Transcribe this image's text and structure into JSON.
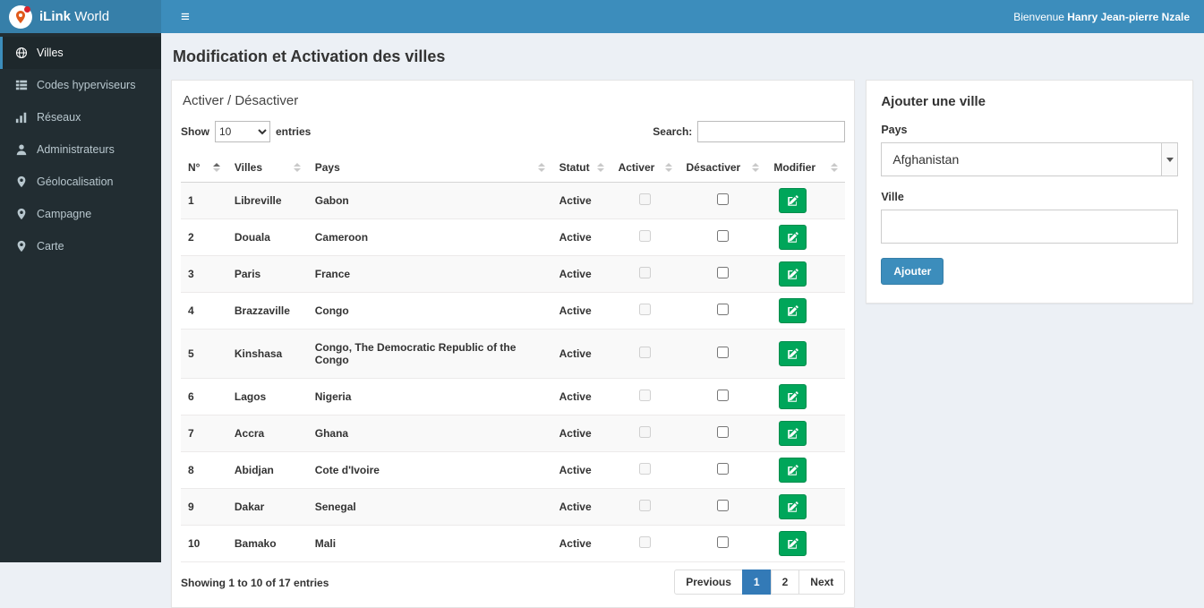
{
  "colors": {
    "header_bg": "#3c8dbc",
    "logo_bg": "#367fa9",
    "sidebar_bg": "#222d32",
    "sidebar_active_bg": "#1e282c",
    "edit_button_green": "#00a65a",
    "primary_button_blue": "#3c8dbc",
    "pagination_active_blue": "#337ab7",
    "body_bg": "#ecf0f5"
  },
  "header": {
    "menu_icon": "≡",
    "brand_bold": "iLink",
    "brand_rest": "World",
    "welcome_prefix": "Bienvenue",
    "welcome_name": "Hanry Jean-pierre Nzale"
  },
  "sidebar": {
    "items": [
      {
        "label": "Villes",
        "icon": "globe-icon",
        "active": true
      },
      {
        "label": "Codes hyperviseurs",
        "icon": "list-icon",
        "active": false
      },
      {
        "label": "Réseaux",
        "icon": "bar-chart-icon",
        "active": false
      },
      {
        "label": "Administrateurs",
        "icon": "user-icon",
        "active": false
      },
      {
        "label": "Géolocalisation",
        "icon": "map-marker-icon",
        "active": false
      },
      {
        "label": "Campagne",
        "icon": "map-marker-icon",
        "active": false
      },
      {
        "label": "Carte",
        "icon": "map-marker-icon",
        "active": false
      }
    ]
  },
  "page": {
    "title": "Modification et Activation des villes"
  },
  "table_panel": {
    "title": "Activer / Désactiver",
    "show_label": "Show",
    "entries_label": "entries",
    "page_length": "10",
    "search_label": "Search:",
    "search_value": "",
    "columns": [
      "N°",
      "Villes",
      "Pays",
      "Statut",
      "Activer",
      "Désactiver",
      "Modifier"
    ],
    "rows": [
      {
        "num": "1",
        "ville": "Libreville",
        "pays": "Gabon",
        "statut": "Active"
      },
      {
        "num": "2",
        "ville": "Douala",
        "pays": "Cameroon",
        "statut": "Active"
      },
      {
        "num": "3",
        "ville": "Paris",
        "pays": "France",
        "statut": "Active"
      },
      {
        "num": "4",
        "ville": "Brazzaville",
        "pays": "Congo",
        "statut": "Active"
      },
      {
        "num": "5",
        "ville": "Kinshasa",
        "pays": "Congo, The Democratic Republic of the Congo",
        "statut": "Active"
      },
      {
        "num": "6",
        "ville": "Lagos",
        "pays": "Nigeria",
        "statut": "Active"
      },
      {
        "num": "7",
        "ville": "Accra",
        "pays": "Ghana",
        "statut": "Active"
      },
      {
        "num": "8",
        "ville": "Abidjan",
        "pays": "Cote d'Ivoire",
        "statut": "Active"
      },
      {
        "num": "9",
        "ville": "Dakar",
        "pays": "Senegal",
        "statut": "Active"
      },
      {
        "num": "10",
        "ville": "Bamako",
        "pays": "Mali",
        "statut": "Active"
      }
    ],
    "footer": {
      "info": "Showing 1 to 10 of 17 entries",
      "prev_label": "Previous",
      "page_1": "1",
      "page_2": "2",
      "next_label": "Next",
      "active_page": "1"
    }
  },
  "add_panel": {
    "title": "Ajouter une ville",
    "pays_label": "Pays",
    "pays_value": "Afghanistan",
    "ville_label": "Ville",
    "ville_value": "",
    "submit_label": "Ajouter"
  }
}
